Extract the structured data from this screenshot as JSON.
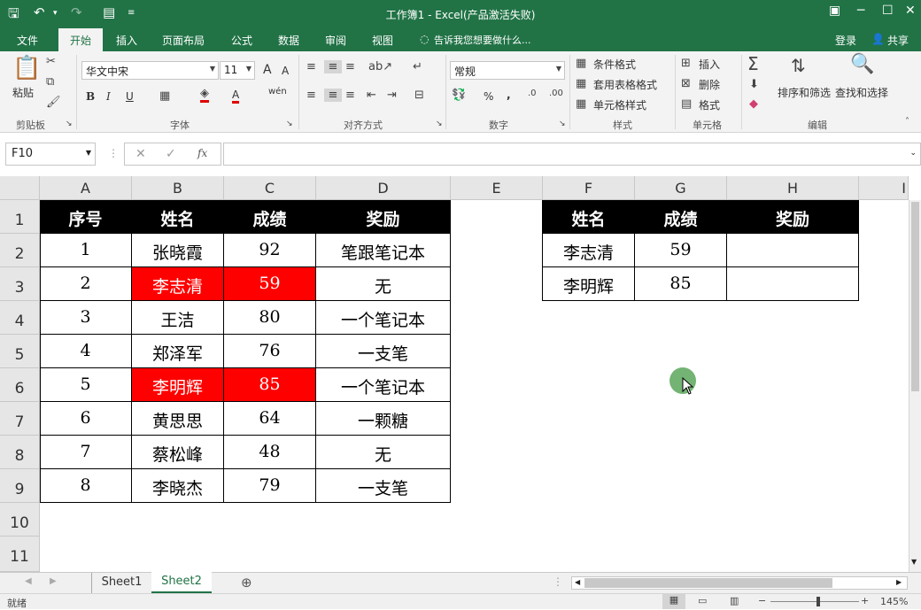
{
  "window": {
    "title": "工作簿1 - Excel(产品激活失败)"
  },
  "tabs": [
    "文件",
    "开始",
    "插入",
    "页面布局",
    "公式",
    "数据",
    "审阅",
    "视图"
  ],
  "tell_me": "告诉我您想要做什么...",
  "account": {
    "login": "登录",
    "share": "共享"
  },
  "ribbon": {
    "clipboard": {
      "paste": "粘贴",
      "label": "剪贴板"
    },
    "font": {
      "name": "华文中宋",
      "size": "11",
      "label": "字体",
      "bold": "B",
      "italic": "I",
      "underline": "U",
      "grow": "A",
      "shrink": "A",
      "phonetic": "wén"
    },
    "alignment": {
      "label": "对齐方式"
    },
    "number": {
      "format": "常规",
      "label": "数字",
      "percent": "%",
      "comma": ","
    },
    "styles": {
      "conditional": "条件格式",
      "table": "套用表格格式",
      "cell": "单元格样式",
      "label": "样式"
    },
    "cells": {
      "insert": "插入",
      "delete": "删除",
      "format": "格式",
      "label": "单元格"
    },
    "editing": {
      "sort": "排序和筛选",
      "find": "查找和选择",
      "label": "编辑"
    }
  },
  "formula_bar": {
    "name_box": "F10",
    "fx": "fx",
    "formula": ""
  },
  "columns": [
    "A",
    "B",
    "C",
    "D",
    "E",
    "F",
    "G",
    "H",
    "I"
  ],
  "rows": [
    "1",
    "2",
    "3",
    "4",
    "5",
    "6",
    "7",
    "8",
    "9",
    "10",
    "11"
  ],
  "table1": {
    "headers": [
      "序号",
      "姓名",
      "成绩",
      "奖励"
    ],
    "rows": [
      [
        "1",
        "张晓霞",
        "92",
        "笔跟笔记本"
      ],
      [
        "2",
        "李志清",
        "59",
        "无"
      ],
      [
        "3",
        "王洁",
        "80",
        "一个笔记本"
      ],
      [
        "4",
        "郑泽军",
        "76",
        "一支笔"
      ],
      [
        "5",
        "李明辉",
        "85",
        "一个笔记本"
      ],
      [
        "6",
        "黄思思",
        "64",
        "一颗糖"
      ],
      [
        "7",
        "蔡松峰",
        "48",
        "无"
      ],
      [
        "8",
        "李晓杰",
        "79",
        "一支笔"
      ]
    ],
    "highlight_color": "#ff0000"
  },
  "table2": {
    "headers": [
      "姓名",
      "成绩",
      "奖励"
    ],
    "rows": [
      [
        "李志清",
        "59",
        ""
      ],
      [
        "李明辉",
        "85",
        ""
      ]
    ]
  },
  "sheets": [
    "Sheet1",
    "Sheet2"
  ],
  "active_sheet": "Sheet2",
  "status": {
    "ready": "就绪",
    "zoom": "145%"
  },
  "colors": {
    "accent": "#217346"
  }
}
